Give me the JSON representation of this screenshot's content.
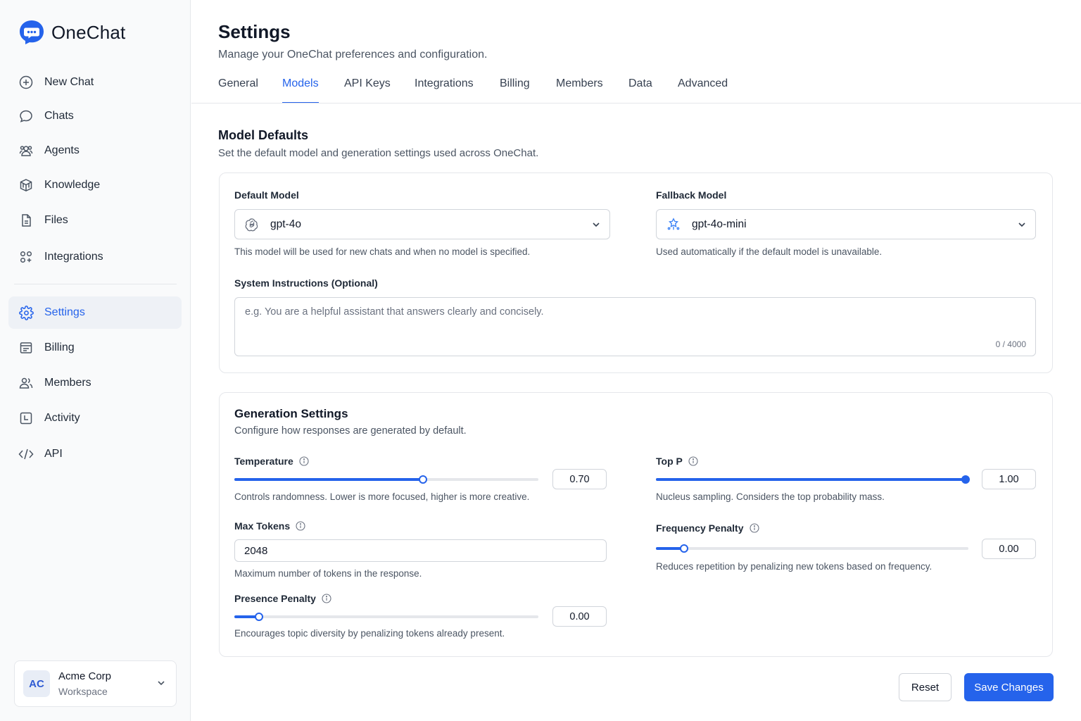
{
  "brand": {
    "name": "OneChat",
    "accent": "#2563eb"
  },
  "sidebar": {
    "items": [
      {
        "label": "New Chat",
        "icon": "plus-circle-icon"
      },
      {
        "label": "Chats",
        "icon": "chat-bubble-icon"
      },
      {
        "label": "Agents",
        "icon": "agents-icon"
      },
      {
        "label": "Knowledge",
        "icon": "knowledge-cube-icon"
      },
      {
        "label": "Files",
        "icon": "file-icon"
      },
      {
        "label": "Integrations",
        "icon": "integrations-icon"
      },
      {
        "label": "Settings",
        "icon": "gear-icon",
        "active": true
      },
      {
        "label": "Billing",
        "icon": "billing-icon"
      },
      {
        "label": "Members",
        "icon": "members-icon"
      },
      {
        "label": "Activity",
        "icon": "activity-icon"
      },
      {
        "label": "API",
        "icon": "code-icon"
      }
    ],
    "workspace": {
      "initials": "AC",
      "name": "Acme Corp",
      "type": "Workspace"
    }
  },
  "header": {
    "title": "Settings",
    "subtitle": "Manage your OneChat preferences and configuration.",
    "tabs": [
      "General",
      "Models",
      "API Keys",
      "Integrations",
      "Billing",
      "Members",
      "Data",
      "Advanced"
    ],
    "active_tab": "Models"
  },
  "model_defaults": {
    "title": "Model Defaults",
    "subtitle": "Set the default model and generation settings used across OneChat.",
    "default_model": {
      "label": "Default Model",
      "value": "gpt-4o",
      "helper": "This model will be used for new chats and when no model is specified."
    },
    "fallback_model": {
      "label": "Fallback Model",
      "value": "gpt-4o-mini",
      "helper": "Used automatically if the default model is unavailable."
    },
    "system_instructions": {
      "label": "System Instructions (Optional)",
      "placeholder": "e.g. You are a helpful assistant that answers clearly and concisely.",
      "value": "",
      "counter": "0 / 4000"
    }
  },
  "generation": {
    "title": "Generation Settings",
    "subtitle": "Configure how responses are generated by default.",
    "temperature": {
      "label": "Temperature",
      "value": "0.70",
      "fraction": 0.62,
      "helper": "Controls randomness. Lower is more focused, higher is more creative."
    },
    "top_p": {
      "label": "Top P",
      "value": "1.00",
      "fraction": 1.0,
      "helper": "Nucleus sampling. Considers the top probability mass."
    },
    "max_tokens": {
      "label": "Max Tokens",
      "value": "2048",
      "helper": "Maximum number of tokens in the response."
    },
    "frequency_penalty": {
      "label": "Frequency Penalty",
      "value": "0.00",
      "fraction": 0.09,
      "helper": "Reduces repetition by penalizing new tokens based on frequency."
    },
    "presence_penalty": {
      "label": "Presence Penalty",
      "value": "0.00",
      "fraction": 0.08,
      "helper": "Encourages topic diversity by penalizing tokens already present."
    }
  },
  "actions": {
    "reset": "Reset",
    "save": "Save Changes"
  }
}
